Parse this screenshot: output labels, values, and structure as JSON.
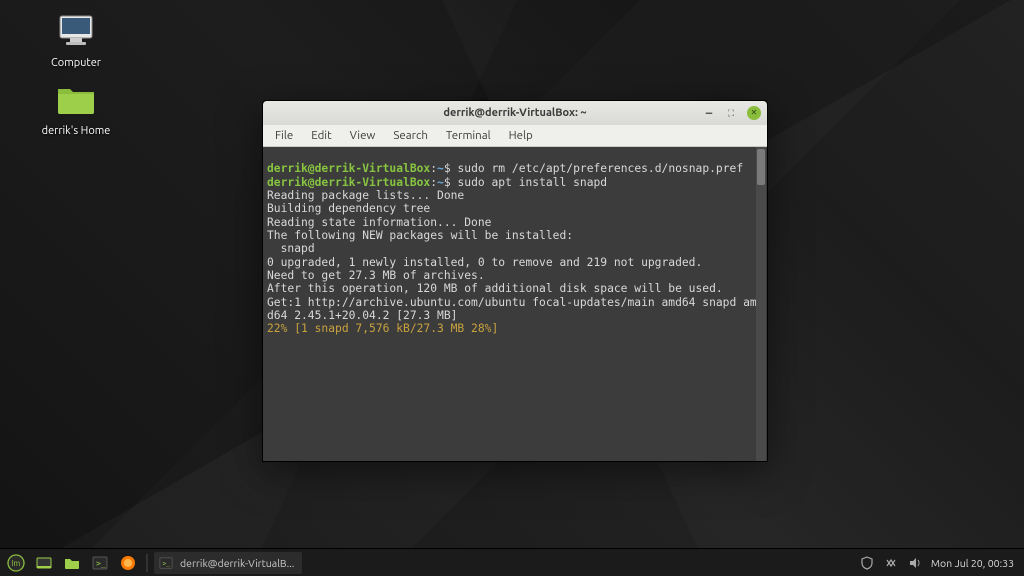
{
  "desktop": {
    "icons": [
      {
        "label": "Computer"
      },
      {
        "label": "derrik's Home"
      }
    ]
  },
  "window": {
    "title": "derrik@derrik-VirtualBox: ~",
    "menu": [
      "File",
      "Edit",
      "View",
      "Search",
      "Terminal",
      "Help"
    ]
  },
  "terminal": {
    "prompt_user": "derrik@derrik-VirtualBox",
    "prompt_path": "~",
    "prompt_symbol": "$",
    "commands": [
      "sudo rm /etc/apt/preferences.d/nosnap.pref",
      "sudo apt install snapd"
    ],
    "output": [
      "Reading package lists... Done",
      "Building dependency tree",
      "Reading state information... Done",
      "The following NEW packages will be installed:",
      "  snapd",
      "0 upgraded, 1 newly installed, 0 to remove and 219 not upgraded.",
      "Need to get 27.3 MB of archives.",
      "After this operation, 120 MB of additional disk space will be used.",
      "Get:1 http://archive.ubuntu.com/ubuntu focal-updates/main amd64 snapd amd64 2.45.1+20.04.2 [27.3 MB]"
    ],
    "progress": "22% [1 snapd 7,576 kB/27.3 MB 28%]"
  },
  "taskbar": {
    "task_label": "derrik@derrik-VirtualB...",
    "clock": "Mon Jul 20, 00:33"
  }
}
